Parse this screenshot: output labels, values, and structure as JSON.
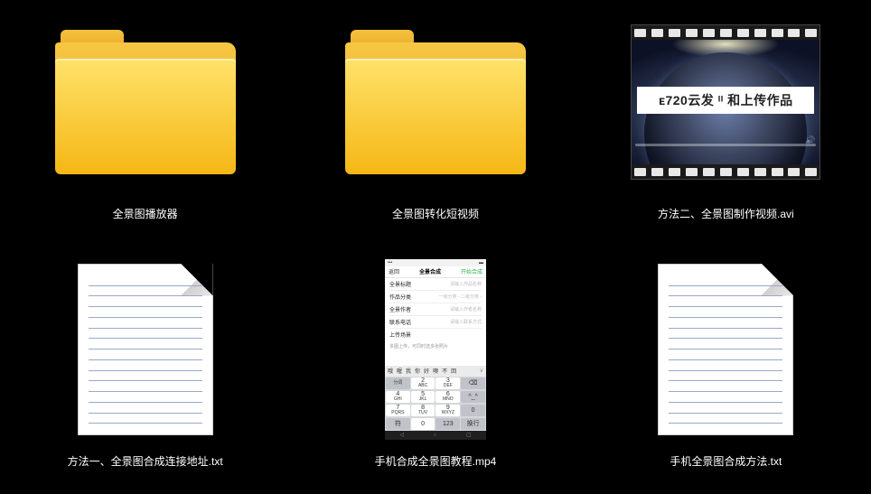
{
  "items": [
    {
      "kind": "folder",
      "label": "全景图播放器"
    },
    {
      "kind": "folder",
      "label": "全景图转化短视频"
    },
    {
      "kind": "video",
      "label": "方法二、全景图制作视频.avi",
      "banner_text": "ᴇ720云发 ᴵᴵ 和上传作品"
    },
    {
      "kind": "text",
      "label": "方法一、全景图合成连接地址.txt"
    },
    {
      "kind": "phone",
      "label": "手机合成全景图教程.mp4"
    },
    {
      "kind": "text",
      "label": "手机全景图合成方法.txt"
    }
  ],
  "phone": {
    "status_left": "•••",
    "status_right": "▬",
    "nav_left": "返回",
    "nav_center": "全景合成",
    "nav_right": "开始合成",
    "rows": [
      {
        "k": "全景标题",
        "v": "请输入作品名称"
      },
      {
        "k": "作品分类",
        "v": "一级分类 - 二级分类 ›"
      },
      {
        "k": "全景作者",
        "v": "请输入作者名称"
      },
      {
        "k": "联系电话",
        "v": "请输入联系方式"
      },
      {
        "k": "上传场景",
        "v": ""
      }
    ],
    "memo": "多图上传，可同时选多张照片",
    "chips": [
      "哦",
      "喔",
      "我",
      "你",
      "好",
      "噢",
      "不",
      "回"
    ],
    "chips_extra": "∨",
    "keys_r1": [
      {
        "n": "1",
        "t": "分词"
      },
      {
        "n": "2",
        "t": "ABC"
      },
      {
        "n": "3",
        "t": "DEF"
      },
      {
        "n": "⌫",
        "t": ""
      }
    ],
    "keys_r2": [
      {
        "n": "4",
        "t": "GHI"
      },
      {
        "n": "5",
        "t": "JKL"
      },
      {
        "n": "6",
        "t": "MNO"
      },
      {
        "n": "^_^",
        "t": ""
      }
    ],
    "keys_r3": [
      {
        "n": "7",
        "t": "PQRS"
      },
      {
        "n": "8",
        "t": "TUV"
      },
      {
        "n": "9",
        "t": "WXYZ"
      },
      {
        "n": "0",
        "t": ""
      }
    ],
    "keys_r4": [
      {
        "n": "符",
        "t": ""
      },
      {
        "n": "0",
        "t": ""
      },
      {
        "n": "123",
        "t": ""
      },
      {
        "n": "换行",
        "t": ""
      }
    ]
  }
}
